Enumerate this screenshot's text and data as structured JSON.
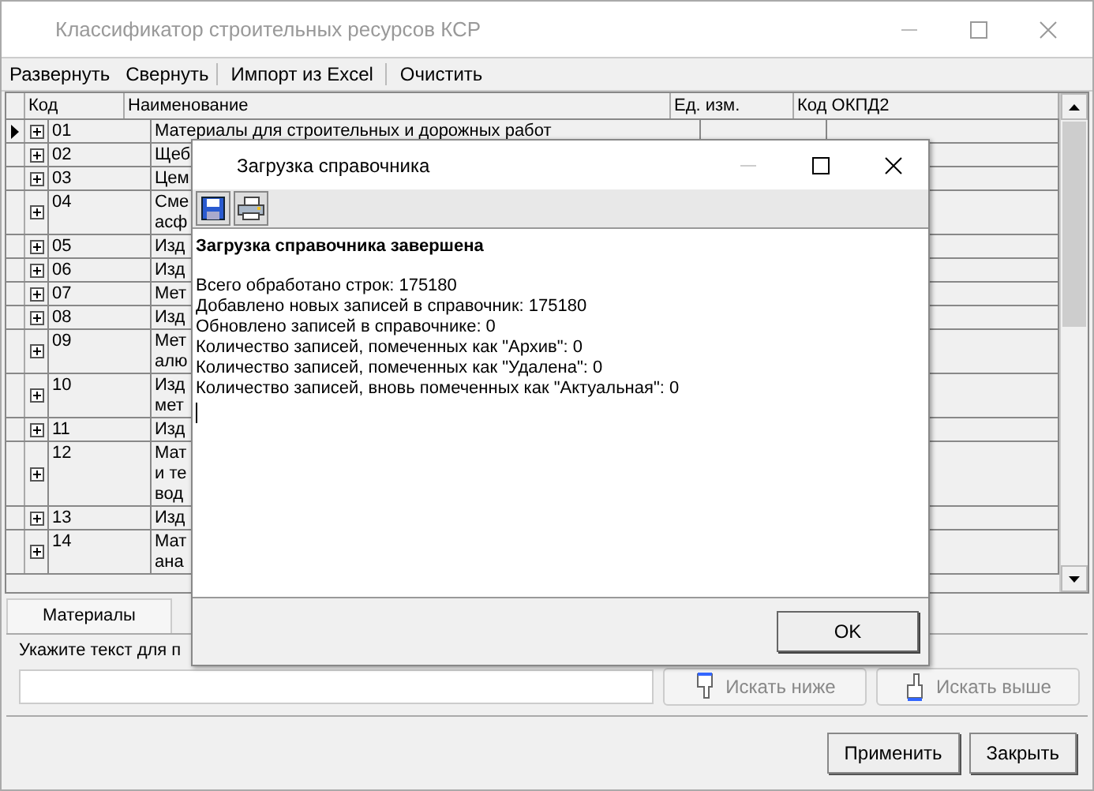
{
  "window": {
    "title": "Классификатор строительных ресурсов КСР"
  },
  "menu": [
    "Развернуть",
    "Свернуть",
    "Импорт из Excel",
    "Очистить"
  ],
  "table": {
    "columns": [
      "Код",
      "Наименование",
      "Ед. изм.",
      "Код ОКПД2"
    ],
    "rows": [
      {
        "code": "01",
        "name": [
          "Материалы для строительных и дорожных работ"
        ],
        "current": true,
        "expanded": false
      },
      {
        "code": "02",
        "name": [
          "Щеб"
        ],
        "current": false,
        "expanded": false
      },
      {
        "code": "03",
        "name": [
          "Цем"
        ],
        "current": false,
        "expanded": false
      },
      {
        "code": "04",
        "name": [
          "Сме",
          "асф"
        ],
        "current": false,
        "expanded": false
      },
      {
        "code": "05",
        "name": [
          "Изд"
        ],
        "current": false,
        "expanded": false
      },
      {
        "code": "06",
        "name": [
          "Изд"
        ],
        "current": false,
        "expanded": false
      },
      {
        "code": "07",
        "name": [
          "Мет"
        ],
        "current": false,
        "expanded": false
      },
      {
        "code": "08",
        "name": [
          "Изд"
        ],
        "current": false,
        "expanded": false
      },
      {
        "code": "09",
        "name": [
          "Мет",
          "алю"
        ],
        "current": false,
        "expanded": false
      },
      {
        "code": "10",
        "name": [
          "Изд",
          "мет"
        ],
        "current": false,
        "expanded": false
      },
      {
        "code": "11",
        "name": [
          "Изд"
        ],
        "current": false,
        "expanded": false
      },
      {
        "code": "12",
        "name": [
          "Мат",
          "и те",
          "вод"
        ],
        "current": false,
        "expanded": false
      },
      {
        "code": "13",
        "name": [
          "Изд"
        ],
        "current": false,
        "expanded": false
      },
      {
        "code": "14",
        "name": [
          "Мат",
          "ана"
        ],
        "current": false,
        "expanded": false
      }
    ]
  },
  "tabs": [
    {
      "label": "Материалы",
      "selected": true
    }
  ],
  "search": {
    "label": "Укажите текст для п",
    "buttons": [
      {
        "label": "Искать ниже",
        "kind": "down",
        "disabled": true
      },
      {
        "label": "Искать выше",
        "kind": "up",
        "disabled": true
      }
    ]
  },
  "buttons": [
    "Применить",
    "Закрыть"
  ],
  "dialog": {
    "title": "Загрузка справочника",
    "heading": "Загрузка справочника завершена",
    "lines": [
      "Всего обработано строк: 175180",
      "Добавлено новых записей в справочник: 175180",
      "Обновлено записей в справочнике: 0",
      "Количество записей, помеченных как \"Архив\": 0",
      "Количество записей, помеченных как \"Удалена\": 0",
      "Количество записей, вновь помеченных как \"Актуальная\": 0"
    ],
    "button": "OK"
  }
}
